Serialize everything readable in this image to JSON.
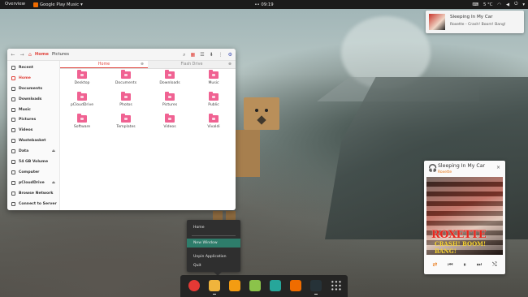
{
  "topbar": {
    "overview": "Overview",
    "app_menu": "Google Play Music",
    "app_menu_caret": "▾",
    "clock": "•• 09:19",
    "temperature": "5 °C",
    "tray_icons": [
      "keyboard-icon",
      "temperature-icon",
      "wifi-icon",
      "volume-icon",
      "power-icon"
    ]
  },
  "notification": {
    "title": "Sleeping In My Car",
    "subtitle": "Roxette - Crash! Boom! Bang!"
  },
  "file_manager": {
    "breadcrumb": [
      "Home",
      "Pictures"
    ],
    "sidebar": [
      {
        "label": "Recent",
        "icon": "clock-icon"
      },
      {
        "label": "Home",
        "icon": "home-icon",
        "active": true
      },
      {
        "label": "Documents",
        "icon": "document-icon"
      },
      {
        "label": "Downloads",
        "icon": "download-icon"
      },
      {
        "label": "Music",
        "icon": "music-icon"
      },
      {
        "label": "Pictures",
        "icon": "picture-icon"
      },
      {
        "label": "Videos",
        "icon": "video-icon"
      },
      {
        "label": "Wastebasket",
        "icon": "trash-icon"
      },
      {
        "label": "Data",
        "icon": "drive-icon",
        "eject": true
      },
      {
        "label": "54 GB Volume",
        "icon": "drive-icon"
      },
      {
        "label": "Computer",
        "icon": "computer-icon"
      },
      {
        "label": "pCloudDrive",
        "icon": "drive-icon",
        "eject": true
      },
      {
        "label": "Browse Network",
        "icon": "network-icon"
      },
      {
        "label": "Connect to Server",
        "icon": "server-icon"
      }
    ],
    "tabs": [
      {
        "label": "Home",
        "active": true
      },
      {
        "label": "Flash Drive",
        "active": false
      }
    ],
    "tab_close": "⊗",
    "folders": [
      "Desktop",
      "Documents",
      "Downloads",
      "Music",
      "pCloudDrive",
      "Photos",
      "Pictures",
      "Public",
      "Software",
      "Templates",
      "Videos",
      "Vivaldi"
    ]
  },
  "music_widget": {
    "title": "Sleeping In My Car",
    "artist": "Roxette",
    "close": "×",
    "cover_text_1": "ROXETTE",
    "cover_text_2": "CRASH! BOOM! BANG!",
    "controls": {
      "repeat": "⇄",
      "previous": "⏮",
      "pause": "⏸",
      "next": "⏭",
      "shuffle": "⤭"
    }
  },
  "dock_menu": {
    "items": [
      "Home",
      "New Window",
      "Unpin Application",
      "Quit"
    ],
    "highlighted": "New Window"
  },
  "dock": {
    "apps": [
      {
        "name": "chrome-icon",
        "color": "#e53935"
      },
      {
        "name": "files-icon",
        "color": "#f0b43c"
      },
      {
        "name": "software-icon",
        "color": "#f39c12"
      },
      {
        "name": "image-viewer-icon",
        "color": "#8bc34a"
      },
      {
        "name": "chat-icon",
        "color": "#26a69a"
      },
      {
        "name": "music-player-icon",
        "color": "#ef6c00"
      },
      {
        "name": "terminal-icon",
        "color": "#263238"
      },
      {
        "name": "app-grid-icon",
        "color": "#bdbdbd"
      }
    ]
  }
}
